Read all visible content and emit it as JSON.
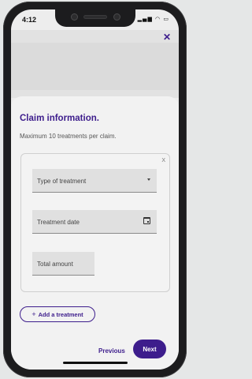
{
  "status_bar": {
    "time": "4:12",
    "icons": "signal wifi battery"
  },
  "header": {
    "close_icon": "close-icon"
  },
  "claim": {
    "title": "Claim information.",
    "subtitle": "Maximum 10 treatments per claim.",
    "treatment": {
      "remove_label": "X",
      "type_placeholder": "Type of treatment",
      "date_placeholder": "Treatment date",
      "amount_placeholder": "Total amount"
    },
    "add_button": "Add a treatment",
    "add_icon": "+"
  },
  "navigation": {
    "previous": "Previous",
    "next": "Next"
  },
  "colors": {
    "accent": "#3d1d8c",
    "field_bg": "#e0e0e0",
    "card_bg": "#f2f2f2"
  }
}
